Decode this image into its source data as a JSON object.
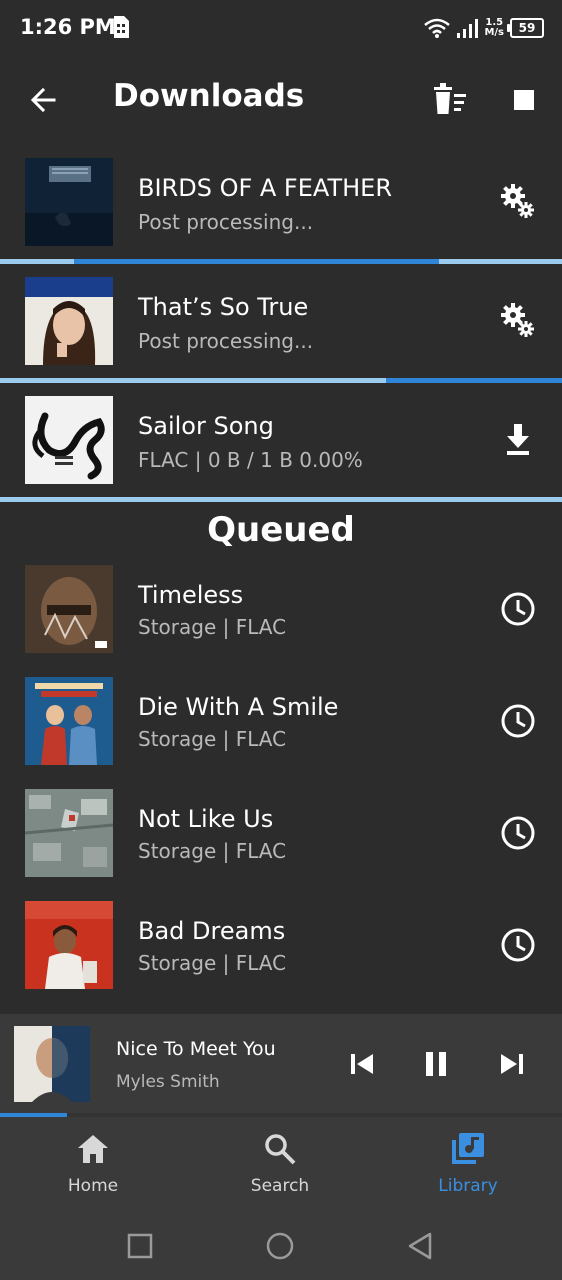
{
  "status_bar": {
    "time": "1:26 PM",
    "net_speed_value": "1.5",
    "net_speed_unit": "M/s",
    "battery": "59"
  },
  "app_bar": {
    "title": "Downloads",
    "back_icon": "arrow-back-icon",
    "clear_icon": "clear-list-icon",
    "stop_icon": "stop-icon"
  },
  "downloads": [
    {
      "title": "BIRDS OF A FEATHER",
      "subtitle": "Post processing...",
      "icon": "settings-gears-icon",
      "progress": 0.65
    },
    {
      "title": "That’s So True",
      "subtitle": "Post processing...",
      "icon": "settings-gears-icon",
      "progress": 0.3
    },
    {
      "title": "Sailor Song",
      "subtitle": "FLAC | 0 B / 1 B 0.00%",
      "icon": "download-icon",
      "progress": 0.0
    }
  ],
  "queued": {
    "heading": "Queued",
    "items": [
      {
        "title": "Timeless",
        "subtitle": "Storage | FLAC",
        "icon": "clock-icon"
      },
      {
        "title": "Die With A Smile",
        "subtitle": "Storage | FLAC",
        "icon": "clock-icon"
      },
      {
        "title": "Not Like Us",
        "subtitle": "Storage | FLAC",
        "icon": "clock-icon"
      },
      {
        "title": "Bad Dreams",
        "subtitle": "Storage | FLAC",
        "icon": "clock-icon"
      }
    ]
  },
  "now_playing": {
    "title": "Nice To Meet You",
    "artist": "Myles Smith",
    "progress": 0.12
  },
  "bottom_nav": [
    {
      "label": "Home",
      "icon": "home-icon",
      "active": false
    },
    {
      "label": "Search",
      "icon": "search-icon",
      "active": false
    },
    {
      "label": "Library",
      "icon": "library-music-icon",
      "active": true
    }
  ],
  "colors": {
    "background": "#2c2c2c",
    "accent": "#2f86d9",
    "progress_track": "#9ccbf0",
    "subtitle": "#b9b9b9"
  }
}
